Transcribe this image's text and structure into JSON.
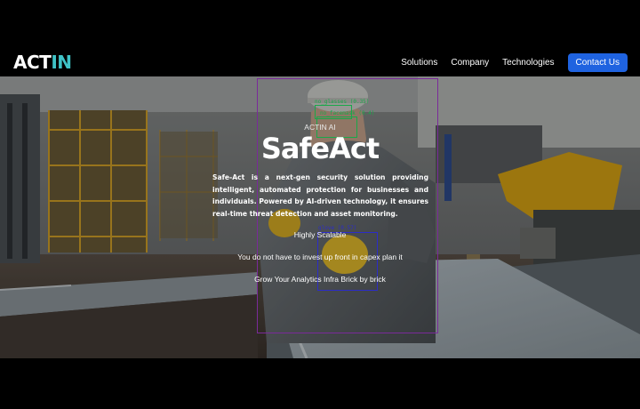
{
  "brand": {
    "logo_main": "ACT",
    "logo_accent": "IN",
    "accent_color": "#3fc3c7"
  },
  "nav": {
    "links": [
      "Solutions",
      "Company",
      "Technologies"
    ],
    "cta": "Contact Us",
    "cta_color": "#1f63e0"
  },
  "hero": {
    "eyebrow": "ACTIN AI",
    "title": "SafeAct",
    "description": "Safe-Act is a next-gen security solution providing intelligent, automated protection for businesses and individuals. Powered by AI-driven technology, it ensures real-time threat detection and asset monitoring.",
    "line1": "Highly Scalable",
    "line2": "You do not have to invest up front in capex plan it",
    "line3": "Grow Your Analytics Infra Brick by brick"
  },
  "detections": [
    {
      "label": "no_glasses (0.35)",
      "color": "#1aa84a"
    },
    {
      "label": "no_facemask (0.4)",
      "color": "#1aa84a"
    },
    {
      "label": "glove (0.57)",
      "color": "#2c2cc8"
    },
    {
      "label": "",
      "color": "#7a2a9a"
    }
  ]
}
